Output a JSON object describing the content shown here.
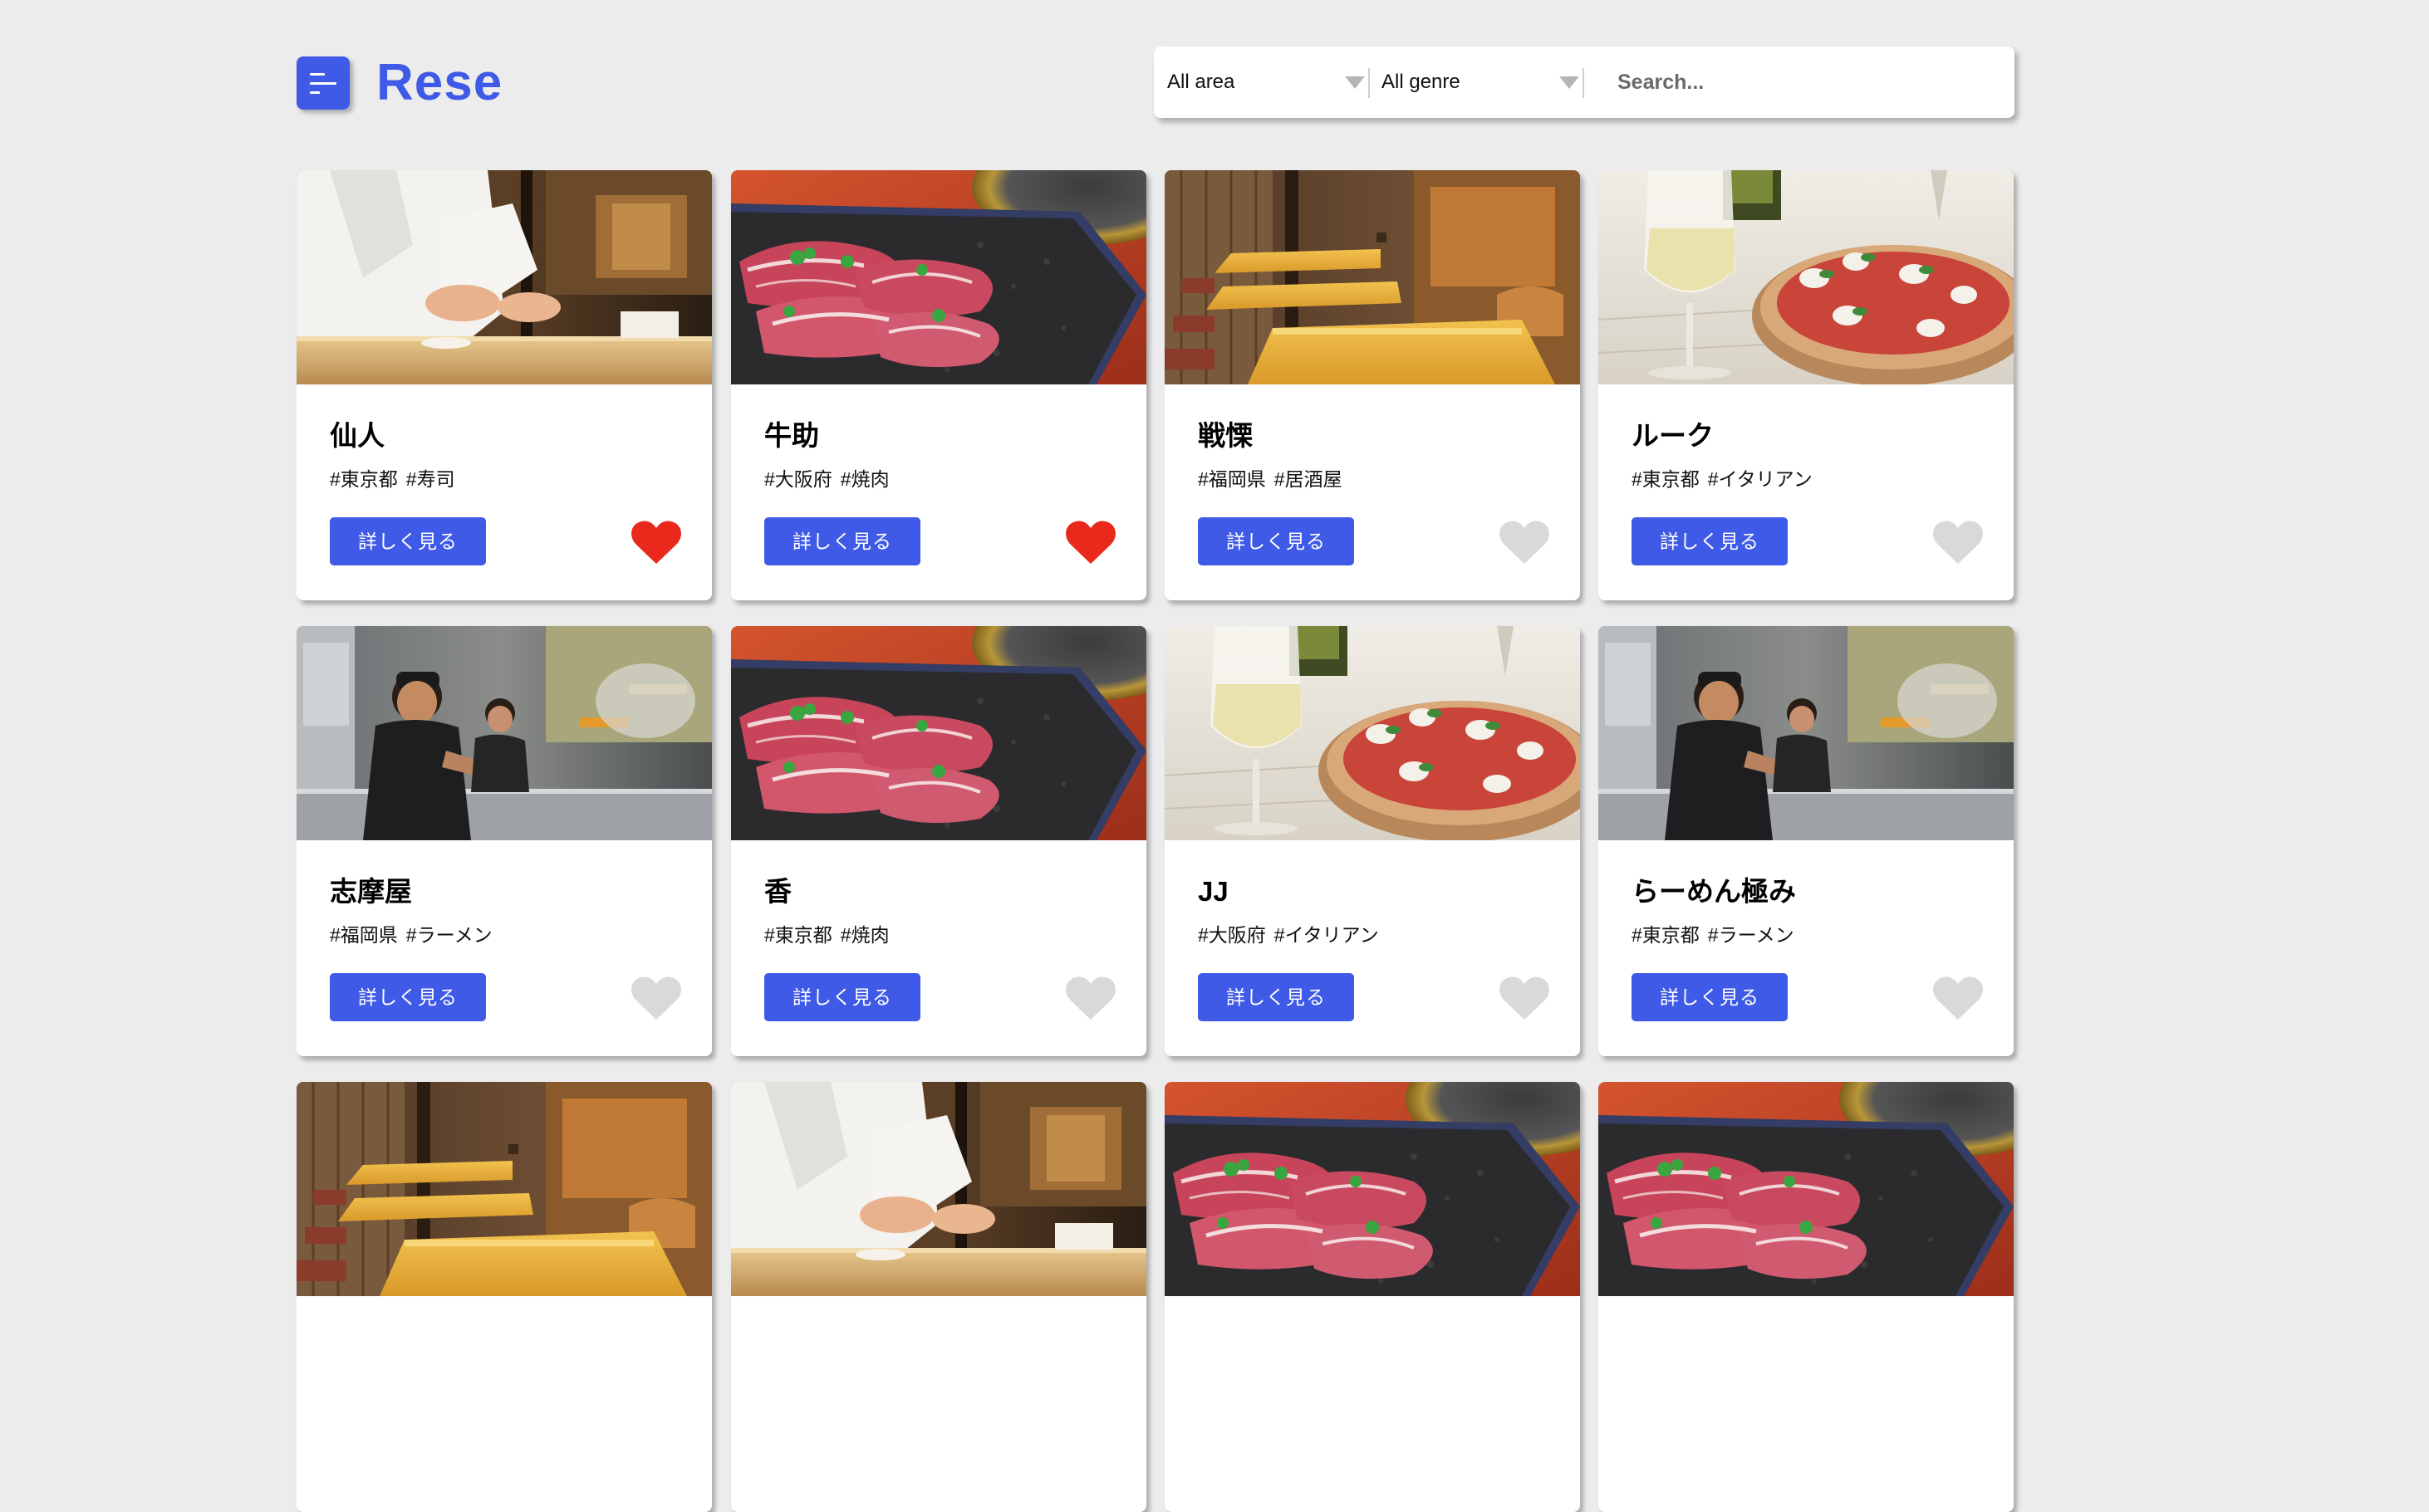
{
  "header": {
    "brand": "Rese",
    "accent_color": "#3f5ae6",
    "menu_icon": "menu-lines-icon"
  },
  "search": {
    "area_selected": "All area",
    "genre_selected": "All genre",
    "placeholder": "Search..."
  },
  "card_button_label": "詳しく見る",
  "colors": {
    "favorite_active": "#e8291c",
    "favorite_inactive": "#d9d9d9"
  },
  "shops": [
    {
      "name": "仙人",
      "area": "#東京都",
      "genre": "#寿司",
      "favorite": true,
      "image": "sushi-chef-photo"
    },
    {
      "name": "牛助",
      "area": "#大阪府",
      "genre": "#焼肉",
      "favorite": true,
      "image": "yakiniku-meat-photo"
    },
    {
      "name": "戦慄",
      "area": "#福岡県",
      "genre": "#居酒屋",
      "favorite": false,
      "image": "izakaya-room-photo"
    },
    {
      "name": "ルーク",
      "area": "#東京都",
      "genre": "#イタリアン",
      "favorite": false,
      "image": "pizza-wine-photo"
    },
    {
      "name": "志摩屋",
      "area": "#福岡県",
      "genre": "#ラーメン",
      "favorite": false,
      "image": "ramen-kitchen-photo"
    },
    {
      "name": "香",
      "area": "#東京都",
      "genre": "#焼肉",
      "favorite": false,
      "image": "yakiniku-meat-photo"
    },
    {
      "name": "JJ",
      "area": "#大阪府",
      "genre": "#イタリアン",
      "favorite": false,
      "image": "pizza-wine-photo"
    },
    {
      "name": "らーめん極み",
      "area": "#東京都",
      "genre": "#ラーメン",
      "favorite": false,
      "image": "ramen-kitchen-photo"
    },
    {
      "image": "izakaya-room-photo"
    },
    {
      "image": "sushi-chef-photo"
    },
    {
      "image": "yakiniku-meat-photo"
    },
    {
      "image": "yakiniku-meat-photo"
    }
  ]
}
